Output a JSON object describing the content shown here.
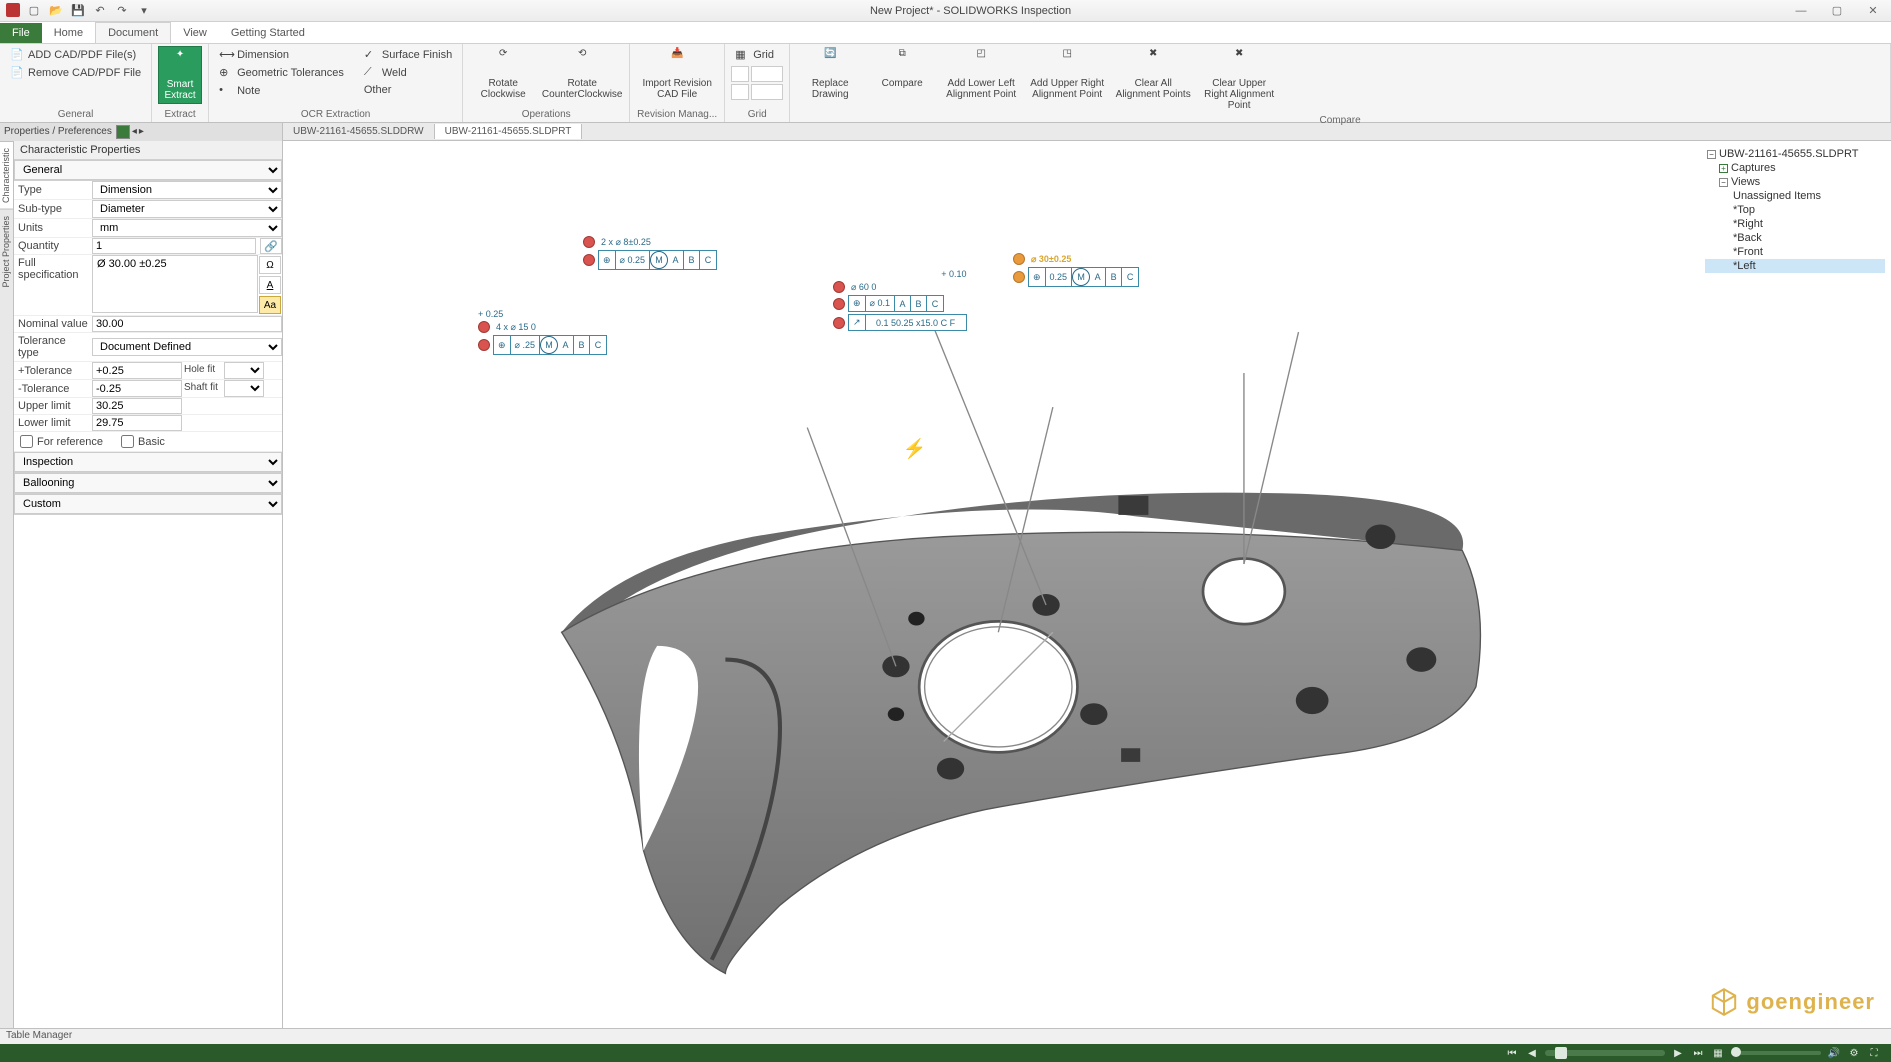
{
  "window": {
    "title": "New Project* - SOLIDWORKS Inspection"
  },
  "tabs": {
    "file": "File",
    "items": [
      "Home",
      "Document",
      "View",
      "Getting Started"
    ],
    "active": "Document"
  },
  "ribbon": {
    "general": {
      "label": "General",
      "add": "ADD CAD/PDF File(s)",
      "remove": "Remove CAD/PDF File"
    },
    "extract": {
      "label": "Extract",
      "smart": "Smart Extract"
    },
    "ocr": {
      "label": "OCR Extraction",
      "dimension": "Dimension",
      "geotol": "Geometric Tolerances",
      "note": "Note",
      "surface": "Surface Finish",
      "weld": "Weld",
      "other": "Other"
    },
    "operations": {
      "label": "Operations",
      "rotcw": "Rotate Clockwise",
      "rotccw": "Rotate CounterClockwise",
      "import": "Import Revision CAD File"
    },
    "revision": {
      "label": "Revision Manag..."
    },
    "grid": {
      "label": "Grid",
      "grid": "Grid"
    },
    "compare": {
      "label": "Compare",
      "replace": "Replace Drawing",
      "compare": "Compare",
      "addll": "Add Lower Left Alignment Point",
      "addur": "Add Upper Right Alignment Point",
      "clearall": "Clear All Alignment Points",
      "clearur": "Clear Upper Right Alignment Point"
    }
  },
  "doctabs": {
    "header": "Properties / Preferences",
    "items": [
      "UBW-21161-45655.SLDDRW",
      "UBW-21161-45655.SLDPRT"
    ],
    "active": 1
  },
  "sidetabs": [
    "Characteristic",
    "Project Properties"
  ],
  "props": {
    "charprops": "Characteristic Properties",
    "general": "General",
    "type_lbl": "Type",
    "type_val": "Dimension",
    "subtype_lbl": "Sub-type",
    "subtype_val": "Diameter",
    "units_lbl": "Units",
    "units_val": "mm",
    "quantity_lbl": "Quantity",
    "quantity_val": "1",
    "fullspec_lbl": "Full specification",
    "fullspec_val": "Ø 30.00 ±0.25",
    "nominal_lbl": "Nominal value",
    "nominal_val": "30.00",
    "toltype_lbl": "Tolerance type",
    "toltype_val": "Document Defined",
    "plustol_lbl": "+Tolerance",
    "plustol_val": "+0.25",
    "minustol_lbl": "-Tolerance",
    "minustol_val": "-0.25",
    "holefit_lbl": "Hole fit",
    "shaftfit_lbl": "Shaft fit",
    "upper_lbl": "Upper limit",
    "upper_val": "30.25",
    "lower_lbl": "Lower limit",
    "lower_val": "29.75",
    "forref": "For reference",
    "basic": "Basic",
    "inspection": "Inspection",
    "ballooning": "Ballooning",
    "custom": "Custom"
  },
  "tree": {
    "root": "UBW-21161-45655.SLDPRT",
    "captures": "Captures",
    "views": "Views",
    "unassigned": "Unassigned Items",
    "items": [
      "*Top",
      "*Right",
      "*Back",
      "*Front",
      "*Left"
    ],
    "selected": "*Left"
  },
  "callouts": {
    "c1": {
      "top": "4 x   ⌀  15    0",
      "plus": "+ 0.25",
      "tol": "⌀ .25",
      "datums": [
        "A",
        "B",
        "C"
      ]
    },
    "c2": {
      "top": "2 x   ⌀  8±0.25",
      "tol": "⌀ 0.25",
      "datums": [
        "A",
        "B",
        "C"
      ]
    },
    "c3": {
      "top": "⌀ 60    0",
      "plus": "+ 0.10",
      "tol": "⌀ 0.1",
      "datums": [
        "A",
        "B",
        "C"
      ],
      "runout": "0.1 50.25 x15.0  C F"
    },
    "c4": {
      "top": "⌀  30±0.25",
      "tol": "0.25",
      "datums": [
        "A",
        "B",
        "C"
      ]
    }
  },
  "status": {
    "table": "Table Manager"
  },
  "logo": "goengineer"
}
